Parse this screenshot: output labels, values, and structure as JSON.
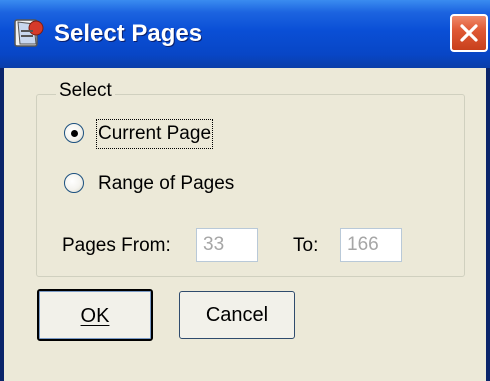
{
  "window": {
    "title": "Select Pages",
    "app_icon": "app-icon",
    "close_icon": "close-icon",
    "close_color": "#e05a36",
    "titlebar_color": "#0a4fd6"
  },
  "group": {
    "label": "Select",
    "options": [
      {
        "label": "Current Page",
        "checked": true,
        "focused": true
      },
      {
        "label": "Range of Pages",
        "checked": false,
        "focused": false
      }
    ],
    "pages_from_label": "Pages From:",
    "pages_from_value": "33",
    "to_label": "To:",
    "to_value": "166"
  },
  "buttons": {
    "ok_label": "OK",
    "cancel_label": "Cancel"
  }
}
